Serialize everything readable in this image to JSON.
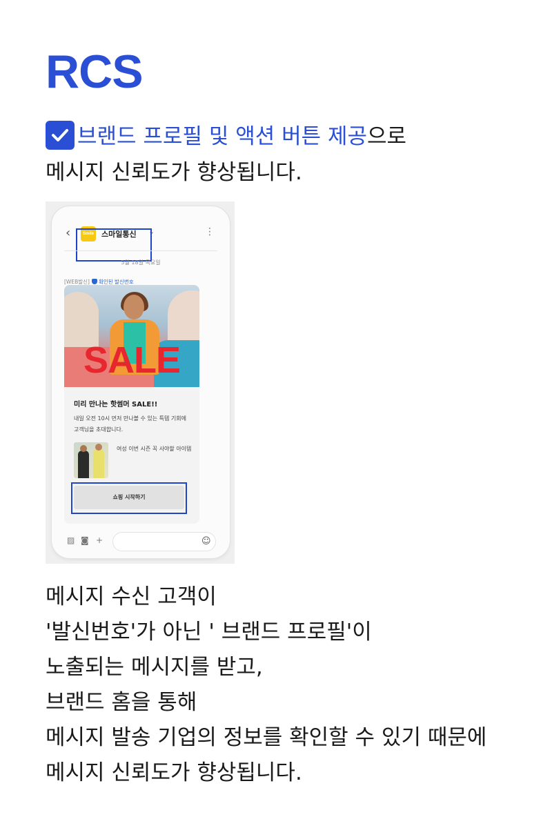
{
  "title": "RCS",
  "lead": {
    "highlight": "브랜드 프로필 및 액션 버튼 제공",
    "suffix": "으로",
    "line2": "메시지 신뢰도가 향상됩니다."
  },
  "phone": {
    "logo_text": "Smile",
    "brand_name": "스마일통신",
    "date": "5월 18일 목요일",
    "sender_tag": "[WEB발신]",
    "verified_label": "확인된 발신번호",
    "hero_text": "SALE",
    "card_title": "미리 만나는 핫썸머 SALE!!",
    "card_desc": "내일 오전 10시 먼저 만나볼 수 있는 특템 기회에 고객님을 초대합니다.",
    "item_text": "여성 이번 시즌 꼭 사야할 아이템",
    "cta_label": "쇼핑 시작하기"
  },
  "body_lines": [
    "메시지 수신 고객이",
    "'발신번호'가 아닌 ' 브랜드 프로필'이",
    "노출되는 메시지를 받고,",
    "브랜드 홈을 통해",
    "메시지 발송 기업의 정보를 확인할 수 있기 때문에",
    "메시지 신뢰도가 향상됩니다."
  ],
  "colors": {
    "accent": "#2a4fd4",
    "highlight_box": "#1e44c8",
    "sale_red": "#e8262e",
    "logo_yellow": "#f6c915"
  }
}
